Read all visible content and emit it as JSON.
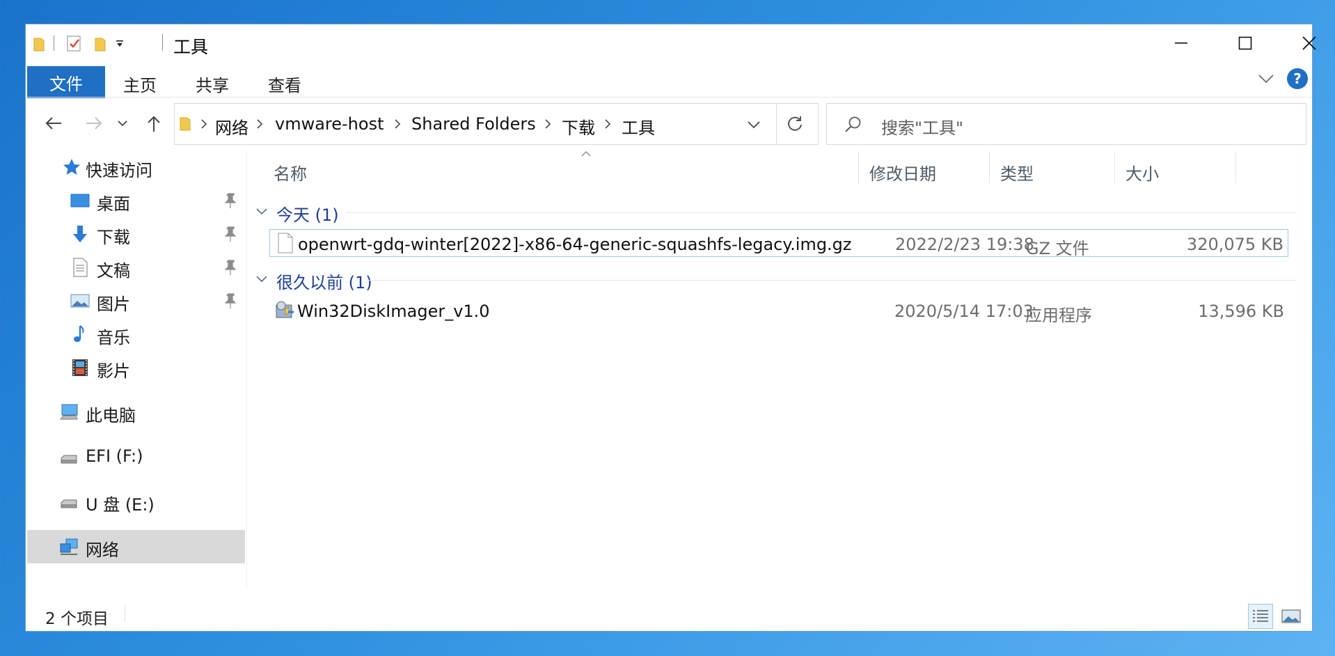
{
  "window": {
    "title": "工具",
    "caption": {
      "minimize": "minimize",
      "maximize": "maximize",
      "close": "close"
    }
  },
  "ribbon": {
    "tabs": [
      {
        "label": "文件",
        "active": true
      },
      {
        "label": "主页"
      },
      {
        "label": "共享"
      },
      {
        "label": "查看"
      }
    ],
    "help_label": "?"
  },
  "address": {
    "crumbs": [
      "网络",
      "vmware-host",
      "Shared Folders",
      "下载",
      "工具"
    ]
  },
  "search": {
    "placeholder": "搜索\"工具\""
  },
  "navpane": {
    "quick_access": "快速访问",
    "pinned": [
      {
        "label": "桌面",
        "icon": "desktop-icon",
        "pinned": true
      },
      {
        "label": "下载",
        "icon": "download-icon",
        "pinned": true
      },
      {
        "label": "文稿",
        "icon": "document-icon",
        "pinned": true
      },
      {
        "label": "图片",
        "icon": "pictures-icon",
        "pinned": true
      },
      {
        "label": "音乐",
        "icon": "music-icon",
        "pinned": false
      },
      {
        "label": "影片",
        "icon": "video-icon",
        "pinned": false
      }
    ],
    "this_pc": "此电脑",
    "drives": [
      {
        "label": "EFI (F:)"
      },
      {
        "label": "U 盘 (E:)"
      }
    ],
    "network": "网络",
    "selected": "网络"
  },
  "columns": {
    "name": "名称",
    "modified": "修改日期",
    "type": "类型",
    "size": "大小"
  },
  "groups": [
    {
      "label": "今天 (1)",
      "files": [
        {
          "name": "openwrt-gdq-winter[2022]-x86-64-generic-squashfs-legacy.img.gz",
          "modified": "2022/2/23 19:38",
          "type": "GZ 文件",
          "size": "320,075 KB",
          "icon": "file-icon",
          "selected": true
        }
      ]
    },
    {
      "label": "很久以前 (1)",
      "files": [
        {
          "name": "Win32DiskImager_v1.0",
          "modified": "2020/5/14 17:03",
          "type": "应用程序",
          "size": "13,596 KB",
          "icon": "installer-icon",
          "selected": false
        }
      ]
    }
  ],
  "status": {
    "item_count": "2 个项目"
  },
  "colors": {
    "accent": "#1f6fc5",
    "selection_border": "#99c9ef",
    "group_text": "#1e3e9a",
    "nav_selected_bg": "#d9d9d9"
  }
}
